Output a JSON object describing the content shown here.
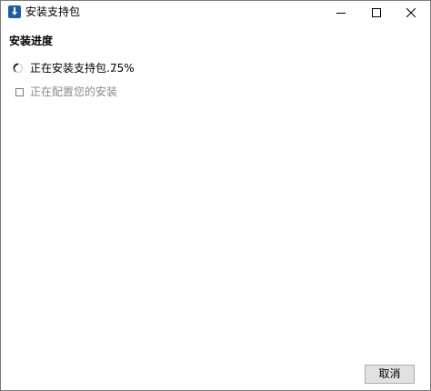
{
  "window": {
    "title": "安装支持包"
  },
  "titlebar": {
    "icons": [
      "download-icon",
      "minimize-icon",
      "maximize-icon",
      "close-icon"
    ]
  },
  "section": {
    "title": "安装进度"
  },
  "steps": [
    {
      "label": "正在安装支持包...",
      "percent": "75%",
      "state": "in-progress",
      "icon": "spinner-icon"
    },
    {
      "label": "正在配置您的安装",
      "state": "pending",
      "icon": "checkbox-icon"
    }
  ],
  "footer": {
    "cancel_label": "取消"
  },
  "colors": {
    "accent": "#1a5ea8",
    "pending_text": "#8a8a8a",
    "button_bg": "#e1e1e1"
  }
}
